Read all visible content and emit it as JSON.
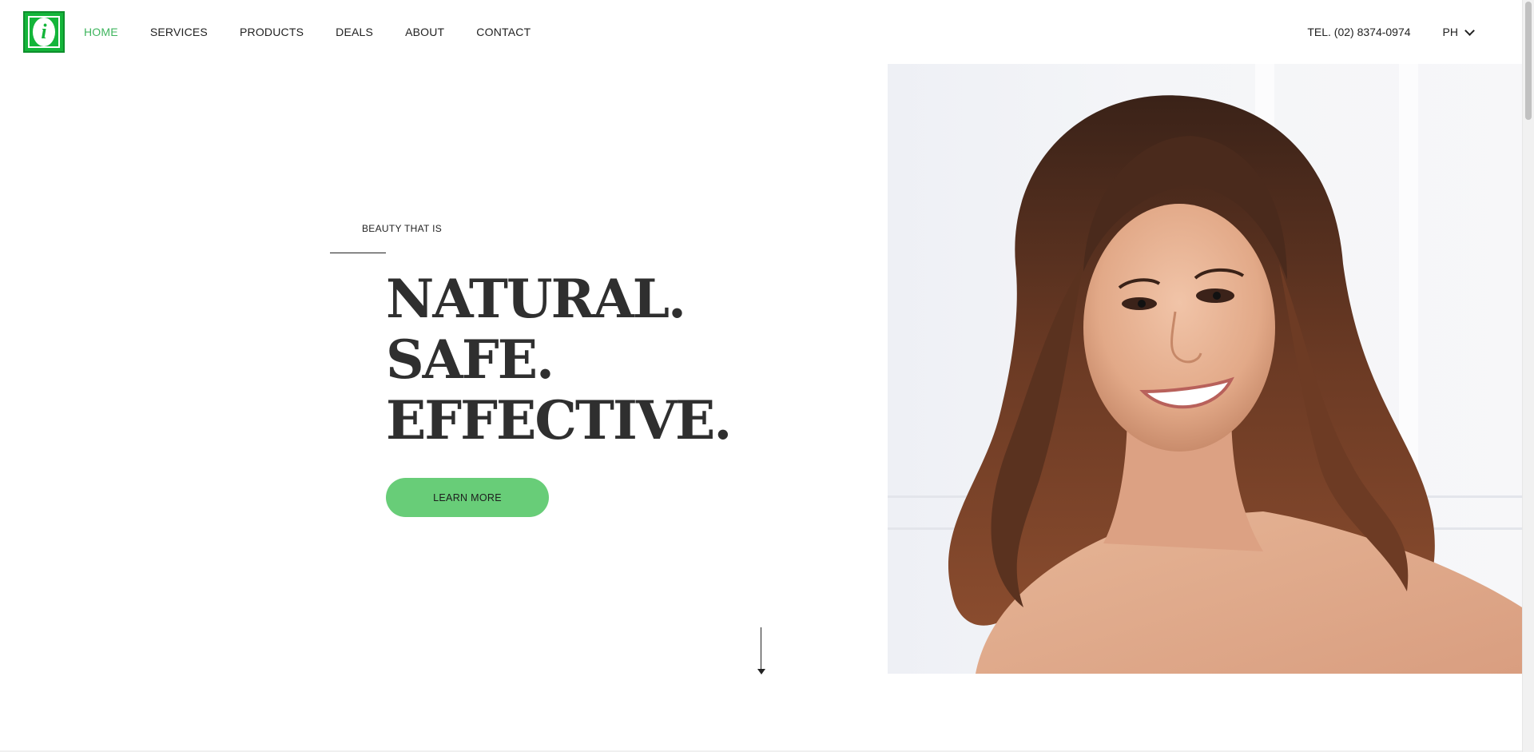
{
  "header": {
    "logo_letter": "i",
    "nav": [
      {
        "label": "HOME",
        "active": true
      },
      {
        "label": "SERVICES",
        "active": false
      },
      {
        "label": "PRODUCTS",
        "active": false
      },
      {
        "label": "DEALS",
        "active": false
      },
      {
        "label": "ABOUT",
        "active": false
      },
      {
        "label": "CONTACT",
        "active": false
      }
    ],
    "phone": "TEL. (02) 8374-0974",
    "language": "PH"
  },
  "hero": {
    "kicker": "BEAUTY THAT IS",
    "headline": [
      "NATURAL.",
      "SAFE.",
      "EFFECTIVE."
    ],
    "cta_label": "LEARN MORE"
  },
  "colors": {
    "accent_green": "#3fb55e",
    "button_green": "#68cd78",
    "logo_green": "#14b53a",
    "headline": "#2f2f2f"
  },
  "icons": {
    "dropdown": "chevron-down-icon",
    "scroll": "arrow-down-icon"
  }
}
